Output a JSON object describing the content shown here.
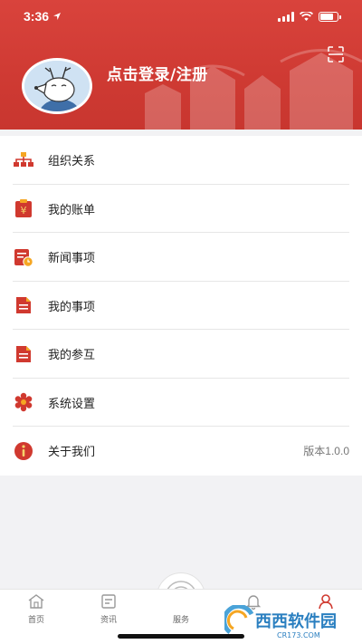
{
  "status_bar": {
    "time": "3:36"
  },
  "header": {
    "login_label": "点击登录/注册"
  },
  "menu": {
    "items": [
      {
        "label": "组织关系",
        "icon": "org-chart-icon"
      },
      {
        "label": "我的账单",
        "icon": "bill-icon"
      },
      {
        "label": "新闻事项",
        "icon": "news-calendar-icon"
      },
      {
        "label": "我的事项",
        "icon": "document-icon"
      },
      {
        "label": "我的参互",
        "icon": "document-icon"
      },
      {
        "label": "系统设置",
        "icon": "gear-icon"
      },
      {
        "label": "关于我们",
        "icon": "info-icon",
        "value": "版本1.0.0"
      }
    ]
  },
  "tabbar": {
    "tabs": [
      {
        "label": "首页",
        "icon": "home-icon"
      },
      {
        "label": "资讯",
        "icon": "news-icon"
      },
      {
        "label": "服务",
        "icon": "service-icon"
      },
      {
        "label": "",
        "icon": "bell-icon"
      },
      {
        "label": "",
        "icon": "profile-icon"
      }
    ]
  },
  "watermark": {
    "text": "西西软件园",
    "sub": "CR173.COM"
  },
  "colors": {
    "brand_red": "#d0392f",
    "accent_orange": "#f5a623",
    "text": "#222222",
    "muted": "#777777"
  }
}
